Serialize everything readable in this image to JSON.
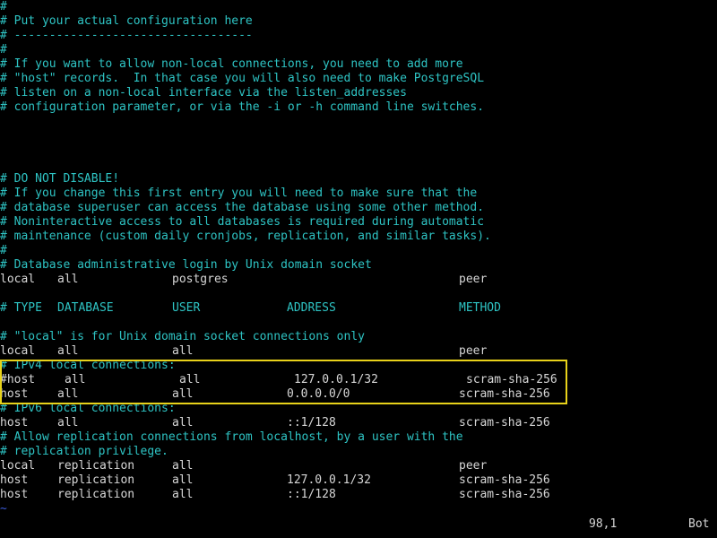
{
  "lines": [
    {
      "type": "comment",
      "text": "#"
    },
    {
      "type": "comment",
      "text": "# Put your actual configuration here"
    },
    {
      "type": "comment",
      "text": "# ----------------------------------"
    },
    {
      "type": "comment",
      "text": "#"
    },
    {
      "type": "comment",
      "text": "# If you want to allow non-local connections, you need to add more"
    },
    {
      "type": "comment",
      "text": "# \"host\" records.  In that case you will also need to make PostgreSQL"
    },
    {
      "type": "comment",
      "text": "# listen on a non-local interface via the listen_addresses"
    },
    {
      "type": "comment",
      "text": "# configuration parameter, or via the -i or -h command line switches."
    },
    {
      "type": "blank",
      "text": ""
    },
    {
      "type": "blank",
      "text": ""
    },
    {
      "type": "blank",
      "text": ""
    },
    {
      "type": "blank",
      "text": ""
    },
    {
      "type": "comment",
      "text": "# DO NOT DISABLE!"
    },
    {
      "type": "comment",
      "text": "# If you change this first entry you will need to make sure that the"
    },
    {
      "type": "comment",
      "text": "# database superuser can access the database using some other method."
    },
    {
      "type": "comment",
      "text": "# Noninteractive access to all databases is required during automatic"
    },
    {
      "type": "comment",
      "text": "# maintenance (custom daily cronjobs, replication, and similar tasks)."
    },
    {
      "type": "comment",
      "text": "#"
    },
    {
      "type": "comment",
      "text": "# Database administrative login by Unix domain socket"
    },
    {
      "type": "entry",
      "cells": [
        "local",
        "all",
        "postgres",
        "",
        "peer"
      ]
    },
    {
      "type": "blank",
      "text": ""
    },
    {
      "type": "header",
      "cells": [
        "# TYPE",
        "DATABASE",
        "USER",
        "ADDRESS",
        "METHOD"
      ]
    },
    {
      "type": "blank",
      "text": ""
    },
    {
      "type": "comment",
      "text": "# \"local\" is for Unix domain socket connections only"
    },
    {
      "type": "entry",
      "cells": [
        "local",
        "all",
        "all",
        "",
        "peer"
      ]
    },
    {
      "type": "comment",
      "text": "# IPv4 local connections:"
    },
    {
      "type": "entry",
      "variant": "commented",
      "cells": [
        "#host",
        "all",
        "all",
        "127.0.0.1/32",
        "scram-sha-256"
      ]
    },
    {
      "type": "entry",
      "cells": [
        "host",
        "all",
        "all",
        "0.0.0.0/0",
        "scram-sha-256"
      ]
    },
    {
      "type": "comment",
      "text": "# IPv6 local connections:"
    },
    {
      "type": "entry",
      "cells": [
        "host",
        "all",
        "all",
        "::1/128",
        "scram-sha-256"
      ]
    },
    {
      "type": "comment",
      "text": "# Allow replication connections from localhost, by a user with the"
    },
    {
      "type": "comment",
      "text": "# replication privilege."
    },
    {
      "type": "entry",
      "cells": [
        "local",
        "replication",
        "all",
        "",
        "peer"
      ]
    },
    {
      "type": "entry",
      "cells": [
        "host",
        "replication",
        "all",
        "127.0.0.1/32",
        "scram-sha-256"
      ]
    },
    {
      "type": "entry",
      "cells": [
        "host",
        "replication",
        "all",
        "::1/128",
        "scram-sha-256"
      ]
    },
    {
      "type": "tilde",
      "text": "~"
    }
  ],
  "status": {
    "position": "98,1",
    "scroll": "Bot"
  },
  "colors": {
    "comment": "#2ec4c4",
    "text": "#d7d7d7",
    "tilde": "#3b5bdb",
    "highlight_border": "#e8d21a",
    "background": "#000000"
  }
}
